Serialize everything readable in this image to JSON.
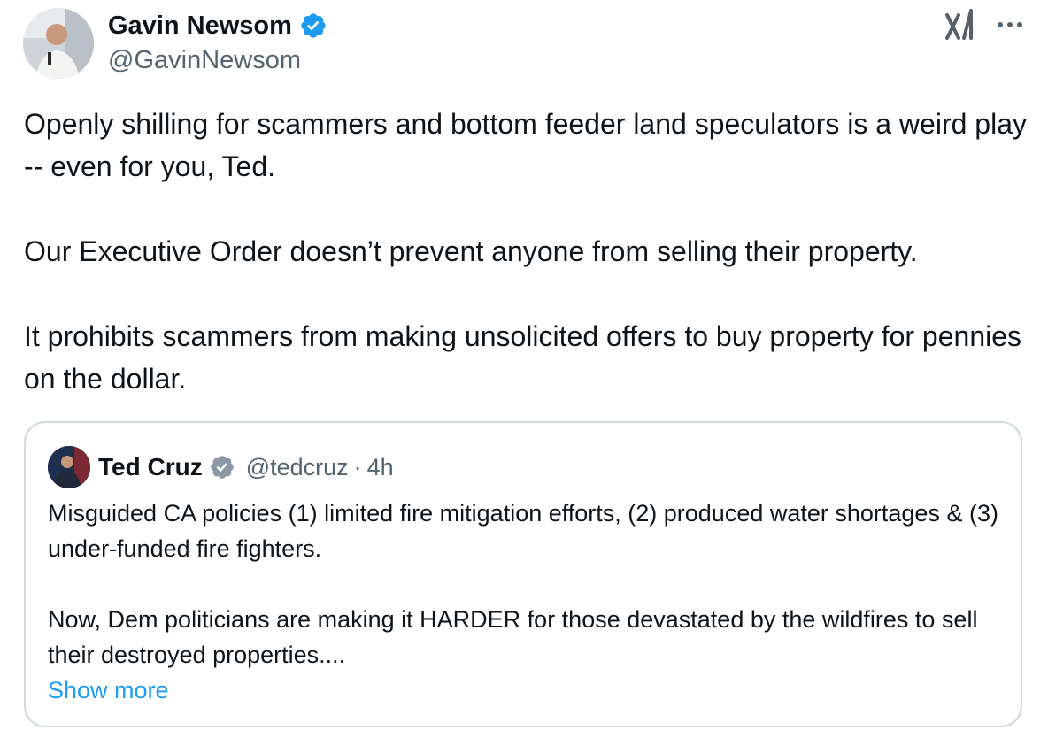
{
  "tweet": {
    "author": {
      "name": "Gavin Newsom",
      "handle": "@GavinNewsom",
      "verified": true,
      "avatar_icon": "profile-photo"
    },
    "paragraphs": [
      "Openly shilling for scammers and bottom feeder land speculators is a weird play -- even for you, Ted.",
      "Our Executive Order doesn’t prevent anyone from selling their property.",
      "It prohibits scammers from making unsolicited offers to buy property for pennies on the dollar."
    ],
    "icons": {
      "platform": "x-logo-icon",
      "menu": "more-options-icon"
    }
  },
  "quote": {
    "author": {
      "name": "Ted Cruz",
      "handle": "@tedcruz",
      "separator": "·",
      "time": "4h",
      "verified": true,
      "avatar_icon": "profile-photo"
    },
    "paragraphs": [
      "Misguided CA policies (1) limited fire mitigation efforts, (2) produced water shortages & (3) under-funded fire fighters.",
      "Now, Dem politicians are making it HARDER for those devastated by the wildfires to sell their destroyed properties...."
    ],
    "show_more": "Show more"
  },
  "colors": {
    "text": "#0f1419",
    "secondary": "#536471",
    "link": "#1d9bf0",
    "verified": "#1d9bf0",
    "border": "#cfd9de"
  }
}
